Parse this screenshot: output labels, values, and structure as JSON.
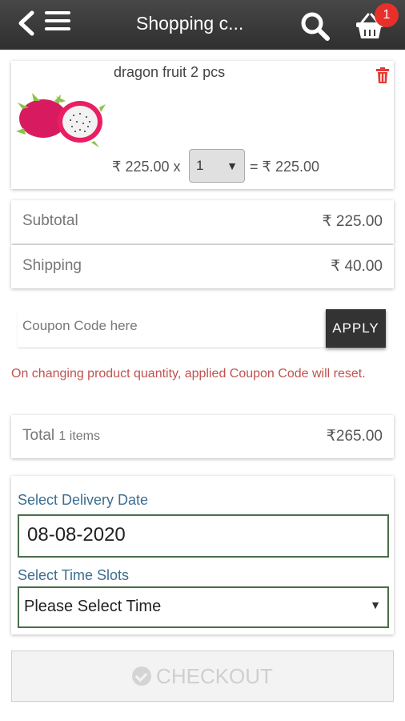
{
  "header": {
    "title": "Shopping c...",
    "cart_badge": "1",
    "icons": [
      "back-arrow-icon",
      "menu-icon",
      "search-icon",
      "basket-icon"
    ]
  },
  "product": {
    "name": "dragon fruit 2 pcs",
    "unit_price": "₹ 225.00 x",
    "quantity": "1",
    "line_total": "= ₹ 225.00"
  },
  "summary": {
    "subtotal_label": "Subtotal",
    "subtotal_value": "₹ 225.00",
    "shipping_label": "Shipping",
    "shipping_value": "₹ 40.00"
  },
  "coupon": {
    "placeholder": "Coupon Code here",
    "apply_label": "APPLY",
    "note": "On changing product quantity, applied Coupon Code will reset."
  },
  "total": {
    "label": "Total",
    "items": "1 items",
    "value": "₹265.00"
  },
  "delivery": {
    "date_label": "Select Delivery Date",
    "date_value": "08-08-2020",
    "time_label": "Select Time Slots",
    "time_value": "Please Select Time"
  },
  "checkout": {
    "label": "CHECKOUT"
  },
  "colors": {
    "topbar": "#3a3a3a",
    "badge": "#e8302a",
    "trash": "#e53935",
    "note": "#c0524e",
    "field_label": "#3c6e8f",
    "field_border": "#4a6e4a"
  }
}
